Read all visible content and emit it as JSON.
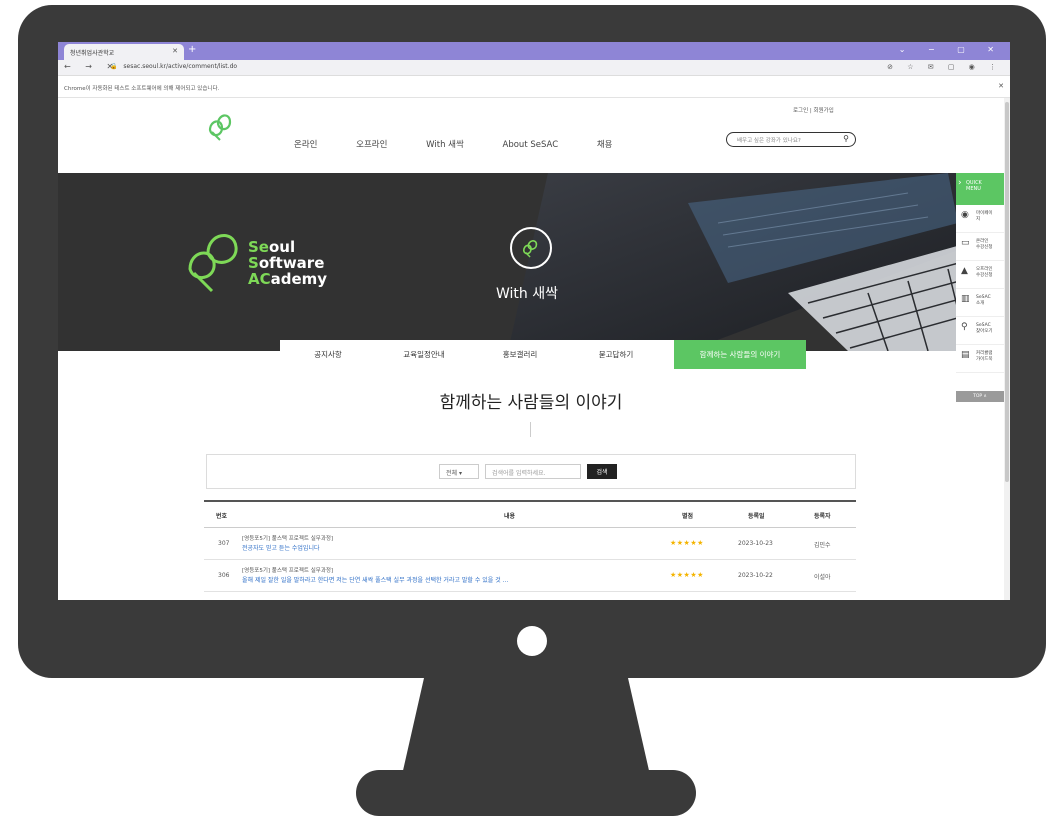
{
  "browser": {
    "tab_title": "청년취업사관학교",
    "url": "sesac.seoul.kr/active/comment/list.do",
    "info_message": "Chrome이 자동화된 테스트 소프트웨어에 의해 제어되고 있습니다.",
    "nav_glyphs": "← → ✕",
    "new_tab": "+",
    "window_controls": "⌄ − ▢ ✕",
    "toolbar_icons": "⊘ ☆ ✉ ▢ ◉ ⋮"
  },
  "header": {
    "util_links": "로그인 | 회원가입",
    "nav": [
      "온라인",
      "오프라인",
      "With 새싹",
      "About SeSAC",
      "채용"
    ],
    "search_placeholder": "배우고 싶은 강좌가 있나요?"
  },
  "hero": {
    "brand_lines": [
      {
        "first": "Se",
        "rest": "oul"
      },
      {
        "first": "S",
        "rest": "oftware"
      },
      {
        "first": "AC",
        "rest": "ademy"
      }
    ],
    "tagline": "With 새싹"
  },
  "subnav": {
    "items": [
      "공지사항",
      "교육일정안내",
      "홍보갤러리",
      "묻고답하기",
      "함께하는 사람들의 이야기"
    ]
  },
  "main": {
    "page_title": "함께하는 사람들의 이야기"
  },
  "search": {
    "select_value": "전체",
    "keyword_placeholder": "검색어를 입력하세요.",
    "button_label": "검색"
  },
  "table": {
    "headers": [
      "번호",
      "내용",
      "별점",
      "등록일",
      "등록자"
    ],
    "rows": [
      {
        "no": "307",
        "category": "[영등포5기] 풀스택 프로젝트 실무과정]",
        "content": "전공자도 믿고 듣는 수업입니다",
        "stars": "★★★★★",
        "date": "2023-10-23",
        "author": "김민수"
      },
      {
        "no": "306",
        "category": "[영등포5기] 풀스택 프로젝트 실무과정]",
        "content": "올해 제일 잘한 일을 말하라고 한다면 저는 단연 새싹 풀스택 실무 과정을 선택한 거라고 말할 수 있을 것 ...",
        "stars": "★★★★★",
        "date": "2023-10-22",
        "author": "이설아"
      }
    ]
  },
  "quick_menu": {
    "title_line1": "QUICK",
    "title_line2": "MENU",
    "items": [
      {
        "line1": "마이페이",
        "line2": "지",
        "icon": "◉"
      },
      {
        "line1": "온라인",
        "line2": "수강신청",
        "icon": "▭"
      },
      {
        "line1": "오프라인",
        "line2": "수강신청",
        "icon": "▲"
      },
      {
        "line1": "SeSAC",
        "line2": "소개",
        "icon": "▥"
      },
      {
        "line1": "SeSAC",
        "line2": "찾아오기",
        "icon": "⚲"
      },
      {
        "line1": "커리큘럼",
        "line2": "가이드북",
        "icon": "▤"
      }
    ],
    "top_label": "TOP ∧"
  }
}
